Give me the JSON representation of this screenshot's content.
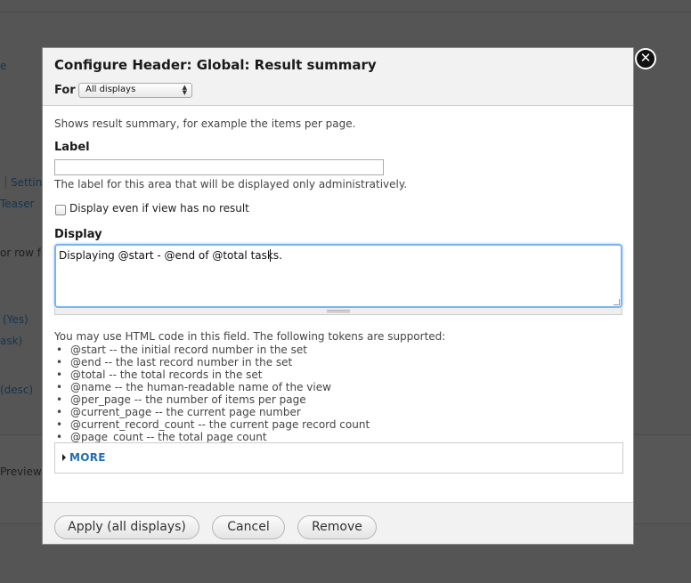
{
  "background": {
    "fragments": [
      "e",
      "Settin",
      "Teaser",
      "or row fo",
      "(Yes)",
      "ask)",
      "(desc)",
      "Preview w"
    ]
  },
  "modal": {
    "title": "Configure Header: Global: Result summary",
    "for_label": "For",
    "for_select_value": "All displays",
    "close_glyph": "✕",
    "description": "Shows result summary, for example the items per page.",
    "label_field": {
      "label": "Label",
      "value": "",
      "help": "The label for this area that will be displayed only administratively."
    },
    "empty_checkbox_label": "Display even if view has no result",
    "display_field": {
      "label": "Display",
      "value": "Displaying @start - @end of @total tasks."
    },
    "tokens": {
      "intro": "You may use HTML code in this field. The following tokens are supported:",
      "items": [
        "@start -- the initial record number in the set",
        "@end -- the last record number in the set",
        "@total -- the total records in the set",
        "@name -- the human-readable name of the view",
        "@per_page -- the number of items per page",
        "@current_page -- the current page number",
        "@current_record_count -- the current page record count",
        "@page_count -- the total page count"
      ]
    },
    "more_label": "MORE",
    "buttons": {
      "apply": "Apply (all displays)",
      "cancel": "Cancel",
      "remove": "Remove"
    }
  },
  "colors": {
    "link": "#1f6db3",
    "focus_ring": "#79b4f2",
    "overlay": "#555555"
  }
}
